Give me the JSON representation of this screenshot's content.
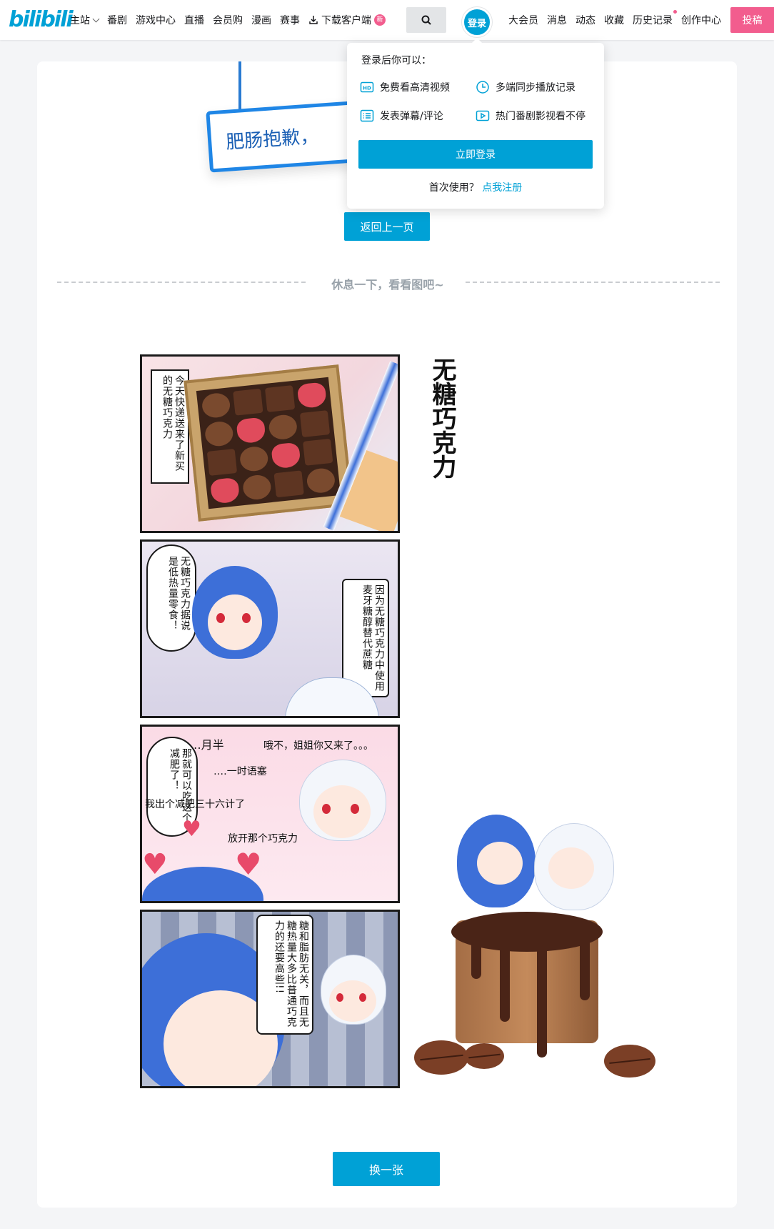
{
  "header": {
    "logo": "bilibili",
    "nav_left": [
      "主站",
      "番剧",
      "游戏中心",
      "直播",
      "会员购",
      "漫画",
      "赛事"
    ],
    "download_label": "下载客户端",
    "new_badge": "新",
    "login_label": "登录",
    "nav_right": [
      "大会员",
      "消息",
      "动态",
      "收藏",
      "历史记录",
      "创作中心"
    ],
    "upload_label": "投稿",
    "accent": "#00a1d6",
    "pink": "#f25d8e"
  },
  "main": {
    "sign_text": "肥肠抱歉，",
    "back_button": "返回上一页",
    "divider_text": "休息一下，看看图吧~",
    "swap_button": "换一张"
  },
  "comic": {
    "title": "无糖巧克力",
    "panel1_box": "今天快递送来了新买的无糖巧克力",
    "panel2_bubble": "无糖巧克力据说是低热量零食！",
    "panel2_box": "因为无糖巧克力中使用麦牙糖醇替代蔗糖",
    "panel3_bubble": "那就可以吃这个减肥了！",
    "panel3_caption_1": "‥月半",
    "panel3_caption_2": "哦不，姐姐你又来了。。。",
    "panel3_caption_3": "‥‥一时语塞",
    "panel3_caption_4": "我出个减肥三十六计了",
    "panel3_caption_5": "放开那个巧克力",
    "panel4_box": "糖和脂肪无关，而且无糖热量大多比普通巧克力的还要高些!!"
  },
  "popup": {
    "title": "登录后你可以：",
    "perks": [
      {
        "label": "免费看高清视频",
        "icon": "hd-icon"
      },
      {
        "label": "多端同步播放记录",
        "icon": "clock-icon"
      },
      {
        "label": "发表弹幕/评论",
        "icon": "list-icon"
      },
      {
        "label": "热门番剧影视看不停",
        "icon": "play-icon"
      }
    ],
    "login_button": "立即登录",
    "first_use": "首次使用？",
    "register_link": "点我注册"
  }
}
